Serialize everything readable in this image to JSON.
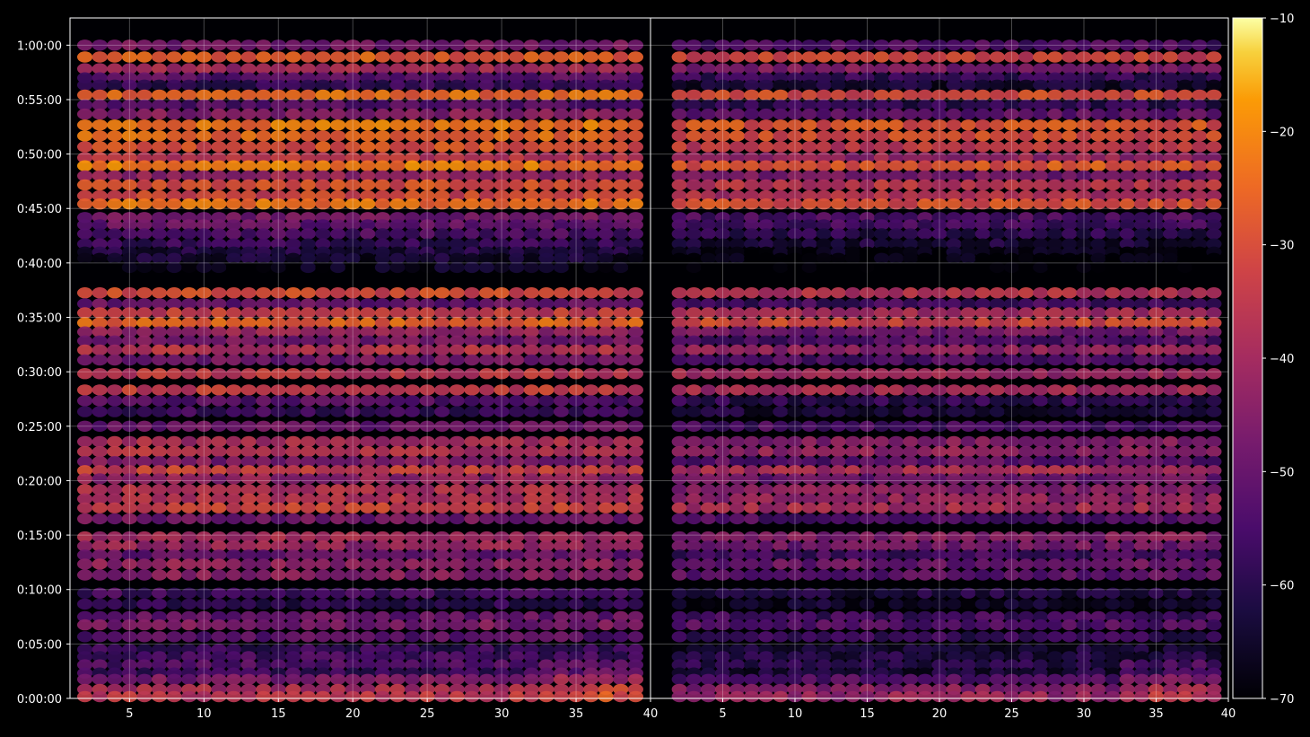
{
  "chart_data": {
    "type": "heatmap",
    "title": "",
    "xlabel": "",
    "ylabel": "",
    "panels": [
      {
        "xlim": [
          1,
          40
        ],
        "x_ticks": [
          5,
          10,
          15,
          20,
          25,
          30,
          35
        ],
        "x_tick_labels": [
          "5",
          "10",
          "15",
          "20",
          "25",
          "30",
          "35"
        ]
      },
      {
        "xlim": [
          0,
          40
        ],
        "x_ticks": [
          5,
          10,
          15,
          20,
          25,
          30,
          35,
          40
        ],
        "x_tick_labels": [
          "5",
          "10",
          "15",
          "20",
          "25",
          "30",
          "35",
          "40"
        ],
        "darker": true
      }
    ],
    "shared_x_label": "40",
    "ylim_seconds": [
      0,
      3750
    ],
    "y_ticks_seconds": [
      0,
      300,
      600,
      900,
      1200,
      1500,
      1800,
      2100,
      2400,
      2700,
      3000,
      3300,
      3600
    ],
    "y_tick_labels": [
      "0:00:00",
      "0:05:00",
      "0:10:00",
      "0:15:00",
      "0:20:00",
      "0:25:00",
      "0:30:00",
      "0:35:00",
      "0:40:00",
      "0:45:00",
      "0:50:00",
      "0:55:00",
      "1:00:00"
    ],
    "colorbar": {
      "colormap": "inferno",
      "range": [
        -70,
        -10
      ],
      "ticks": [
        -10,
        -20,
        -30,
        -40,
        -50,
        -60,
        -70
      ],
      "tick_labels": [
        "−10",
        "−20",
        "−30",
        "−40",
        "−50",
        "−60",
        "−70"
      ]
    },
    "grid": true,
    "rows": [
      {
        "t": 3600,
        "v": -48
      },
      {
        "t": 3535,
        "v": -27
      },
      {
        "t": 3470,
        "v": -40
      },
      {
        "t": 3420,
        "v": -52
      },
      {
        "t": 3380,
        "v": -58
      },
      {
        "t": 3325,
        "v": -25
      },
      {
        "t": 3270,
        "v": -53
      },
      {
        "t": 3220,
        "v": -45
      },
      {
        "t": 3160,
        "v": -23
      },
      {
        "t": 3100,
        "v": -25
      },
      {
        "t": 3040,
        "v": -29
      },
      {
        "t": 2980,
        "v": -36
      },
      {
        "t": 2935,
        "v": -22
      },
      {
        "t": 2880,
        "v": -42
      },
      {
        "t": 2830,
        "v": -30
      },
      {
        "t": 2770,
        "v": -32
      },
      {
        "t": 2725,
        "v": -24
      },
      {
        "t": 2650,
        "v": -48
      },
      {
        "t": 2610,
        "v": -50
      },
      {
        "t": 2560,
        "v": -54
      },
      {
        "t": 2505,
        "v": -57
      },
      {
        "t": 2460,
        "v": -62
      },
      {
        "t": 2425,
        "v": -64
      },
      {
        "t": 2375,
        "v": -67
      },
      {
        "t": 2235,
        "v": -31
      },
      {
        "t": 2175,
        "v": -50
      },
      {
        "t": 2125,
        "v": -34
      },
      {
        "t": 2070,
        "v": -26
      },
      {
        "t": 2020,
        "v": -42
      },
      {
        "t": 1970,
        "v": -48
      },
      {
        "t": 1920,
        "v": -37
      },
      {
        "t": 1865,
        "v": -48
      },
      {
        "t": 1790,
        "v": -35
      },
      {
        "t": 1700,
        "v": -34
      },
      {
        "t": 1640,
        "v": -53
      },
      {
        "t": 1580,
        "v": -57
      },
      {
        "t": 1500,
        "v": -49
      },
      {
        "t": 1415,
        "v": -39
      },
      {
        "t": 1360,
        "v": -37
      },
      {
        "t": 1305,
        "v": -46
      },
      {
        "t": 1255,
        "v": -33
      },
      {
        "t": 1210,
        "v": -43
      },
      {
        "t": 1150,
        "v": -38
      },
      {
        "t": 1100,
        "v": -37
      },
      {
        "t": 1050,
        "v": -33
      },
      {
        "t": 990,
        "v": -48
      },
      {
        "t": 890,
        "v": -39
      },
      {
        "t": 840,
        "v": -42
      },
      {
        "t": 790,
        "v": -50
      },
      {
        "t": 740,
        "v": -43
      },
      {
        "t": 680,
        "v": -45
      },
      {
        "t": 580,
        "v": -56
      },
      {
        "t": 520,
        "v": -59
      },
      {
        "t": 450,
        "v": -50
      },
      {
        "t": 405,
        "v": -47
      },
      {
        "t": 340,
        "v": -52
      },
      {
        "t": 270,
        "v": -58
      },
      {
        "t": 230,
        "v": -56
      },
      {
        "t": 185,
        "v": -54
      },
      {
        "t": 140,
        "v": -57
      },
      {
        "t": 105,
        "v": -47
      },
      {
        "t": 50,
        "v": -39
      },
      {
        "t": 10,
        "v": -36
      }
    ]
  }
}
